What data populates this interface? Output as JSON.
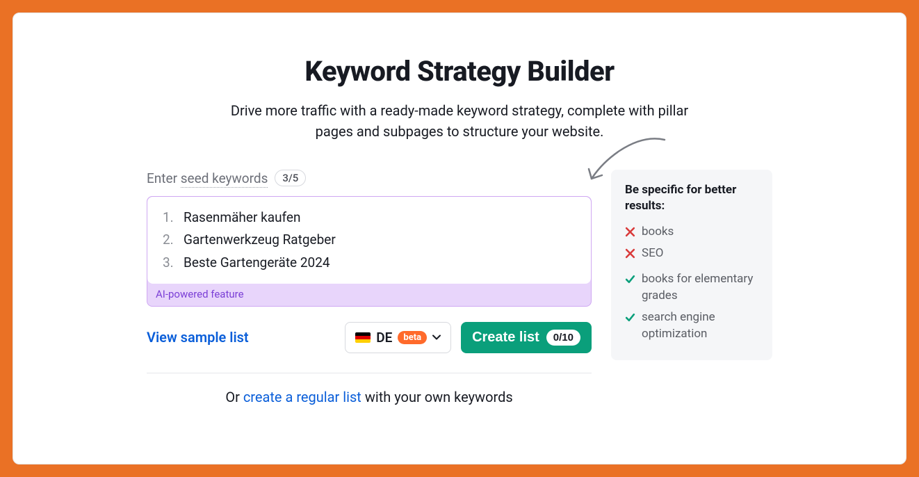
{
  "header": {
    "title": "Keyword Strategy Builder",
    "subtitle": "Drive more traffic with a ready-made keyword strategy, complete with pillar pages and subpages to structure your website."
  },
  "seed": {
    "label_prefix": "Enter ",
    "label_underlined": "seed keywords",
    "count": "3/5",
    "keywords": [
      "Rasenmäher kaufen",
      "Gartenwerkzeug Ratgeber",
      "Beste Gartengeräte 2024"
    ],
    "ai_tag": "AI-powered feature"
  },
  "controls": {
    "view_sample": "View sample list",
    "db_code": "DE",
    "beta": "beta",
    "create_label": "Create list",
    "usage": "0/10"
  },
  "footer": {
    "prefix": "Or ",
    "link": "create a regular list",
    "suffix": " with your own keywords"
  },
  "hint": {
    "title": "Be specific for better results:",
    "bad": [
      "books",
      "SEO"
    ],
    "good": [
      "books for elementary grades",
      "search engine optimization"
    ]
  }
}
